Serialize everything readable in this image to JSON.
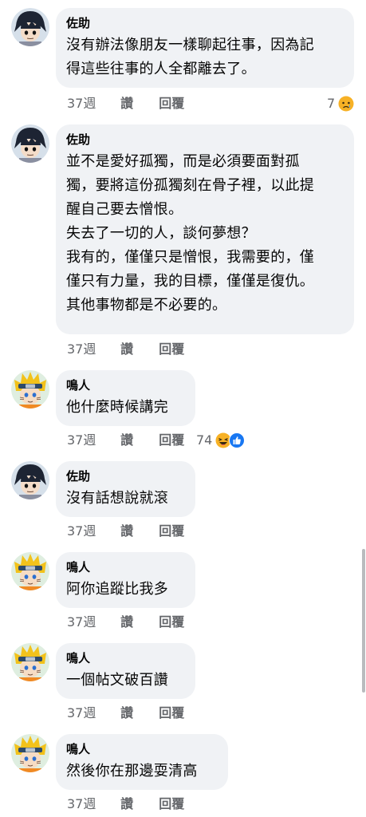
{
  "comments": [
    {
      "author": "佐助",
      "lines": [
        "沒有辦法像朋友一樣聊起往事，因為記",
        "得這些往事的人全都離去了。"
      ],
      "time": "37週",
      "like": "讚",
      "reply": "回覆",
      "reaction_count": "7",
      "reaction_icons": [
        "sad-reaction-icon"
      ]
    },
    {
      "author": "佐助",
      "lines": [
        "並不是愛好孤獨，而是必須要面對孤",
        "獨，要將這份孤獨刻在骨子裡，以此提",
        "醒自己要去憎恨。",
        "失去了一切的人，談何夢想？",
        "我有的，僅僅只是憎恨，我需要的，僅",
        "僅只有力量，我的目標，僅僅是復仇。",
        "其他事物都是不必要的。"
      ],
      "time": "37週",
      "like": "讚",
      "reply": "回覆"
    },
    {
      "author": "鳴人",
      "lines": [
        "他什麼時候講完"
      ],
      "time": "37週",
      "like": "讚",
      "reply": "回覆",
      "reaction_count": "74",
      "reaction_icons": [
        "haha-reaction-icon",
        "like-reaction-icon"
      ]
    },
    {
      "author": "佐助",
      "lines": [
        "沒有話想說就滾"
      ],
      "time": "37週",
      "like": "讚",
      "reply": "回覆"
    },
    {
      "author": "鳴人",
      "lines": [
        "阿你追蹤比我多"
      ],
      "time": "37週",
      "like": "讚",
      "reply": "回覆"
    },
    {
      "author": "鳴人",
      "lines": [
        "一個帖文破百讚"
      ],
      "time": "37週",
      "like": "讚",
      "reply": "回覆"
    },
    {
      "author": "鳴人",
      "lines": [
        "然後你在那邊耍清高"
      ],
      "time": "37週",
      "like": "讚",
      "reply": "回覆"
    }
  ],
  "colors": {
    "bubble": "#f0f2f5",
    "meta_text": "#65676b",
    "like_blue": "#1877f2",
    "reaction_yellow": "#f7b125"
  }
}
